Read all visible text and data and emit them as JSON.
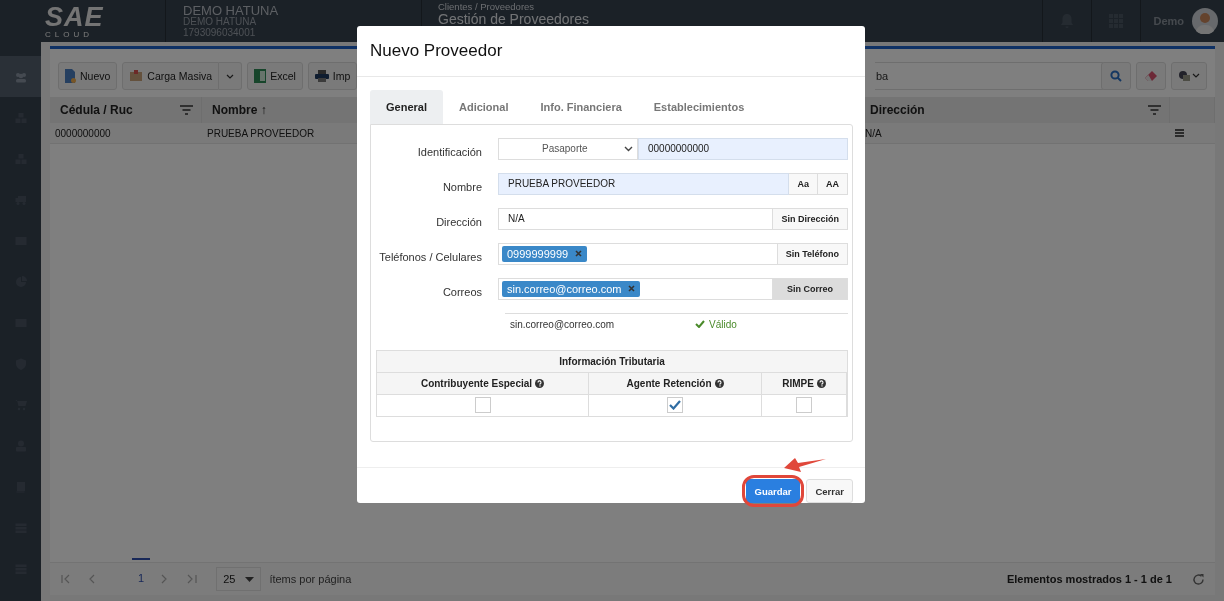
{
  "topbar": {
    "logo": {
      "text": "SAE",
      "subtext": "CLOUD"
    },
    "company": {
      "name": "DEMO HATUNA",
      "subtitle": "DEMO HATUNA",
      "ruc": "1793096034001"
    },
    "breadcrumb": "Clientes / Proveedores",
    "page_title": "Gestión de Proveedores",
    "user": "Demo"
  },
  "sidebar": {
    "items": [
      {
        "selected": true
      },
      {
        "selected": false
      },
      {
        "selected": false
      },
      {
        "selected": false
      },
      {
        "selected": false
      },
      {
        "selected": false
      },
      {
        "selected": false
      },
      {
        "selected": false
      },
      {
        "selected": false
      },
      {
        "selected": false
      },
      {
        "selected": false
      },
      {
        "selected": false
      },
      {
        "selected": false
      }
    ]
  },
  "toolbar": {
    "buttons": [
      {
        "label": "Nuevo",
        "kind": "plain"
      },
      {
        "label": "Carga Masiva",
        "kind": "split"
      },
      {
        "label": "Excel",
        "kind": "plain"
      },
      {
        "label": "Imp",
        "kind": "plain"
      }
    ],
    "search": {
      "value": "ba"
    }
  },
  "table": {
    "columns": [
      {
        "label": "Cédula / Ruc",
        "filterable": true
      },
      {
        "label": "Nombre ↑"
      },
      {
        "label": "Dirección",
        "filterable": true
      }
    ],
    "rows": [
      {
        "cells": [
          "0000000000",
          "PRUEBA PROVEEDOR",
          "N/A"
        ]
      }
    ]
  },
  "pager": {
    "page": "1",
    "page_size": "25",
    "page_size_label": "ítems por página",
    "summary": "Elementos mostrados 1 - 1 de 1"
  },
  "modal": {
    "title": "Nuevo Proveedor",
    "tabs": [
      {
        "label": "General",
        "selected": true
      },
      {
        "label": "Adicional",
        "selected": false
      },
      {
        "label": "Info. Financiera",
        "selected": false
      },
      {
        "label": "Establecimientos",
        "selected": false
      }
    ],
    "fields": [
      {
        "kind": "select-input",
        "label": "Identificación",
        "select": "Pasaporte",
        "value": "00000000000",
        "autofilled": true
      },
      {
        "kind": "text",
        "label": "Nombre",
        "value": "PRUEBA PROVEEDOR",
        "autofilled": true,
        "addons": [
          {
            "label": "Aa",
            "active": false
          },
          {
            "label": "AA",
            "active": false
          }
        ]
      },
      {
        "kind": "text",
        "label": "Dirección",
        "value": "N/A",
        "autofilled": false,
        "addons": [
          {
            "label": "Sin Dirección",
            "active": false
          }
        ]
      },
      {
        "kind": "tags",
        "label": "Teléfonos / Celulares",
        "tags": [
          "0999999999"
        ],
        "addons": [
          {
            "label": "Sin Teléfono",
            "active": false
          }
        ]
      },
      {
        "kind": "tags",
        "label": "Correos",
        "tags": [
          "sin.correo@correo.com"
        ],
        "addons": [
          {
            "label": "Sin Correo",
            "active": true
          }
        ]
      }
    ],
    "validation": [
      {
        "email": "sin.correo@correo.com",
        "status": "Válido",
        "valid": true
      }
    ],
    "tax_info": {
      "title": "Información Tributaria",
      "columns": [
        {
          "label": "Contribuyente Especial",
          "checked": false
        },
        {
          "label": "Agente Retención",
          "checked": true
        },
        {
          "label": "RIMPE",
          "checked": false
        }
      ]
    },
    "buttons": [
      {
        "label": "Guardar",
        "kind": "primary",
        "highlighted": true
      },
      {
        "label": "Cerrar",
        "kind": "default",
        "highlighted": false
      }
    ]
  }
}
